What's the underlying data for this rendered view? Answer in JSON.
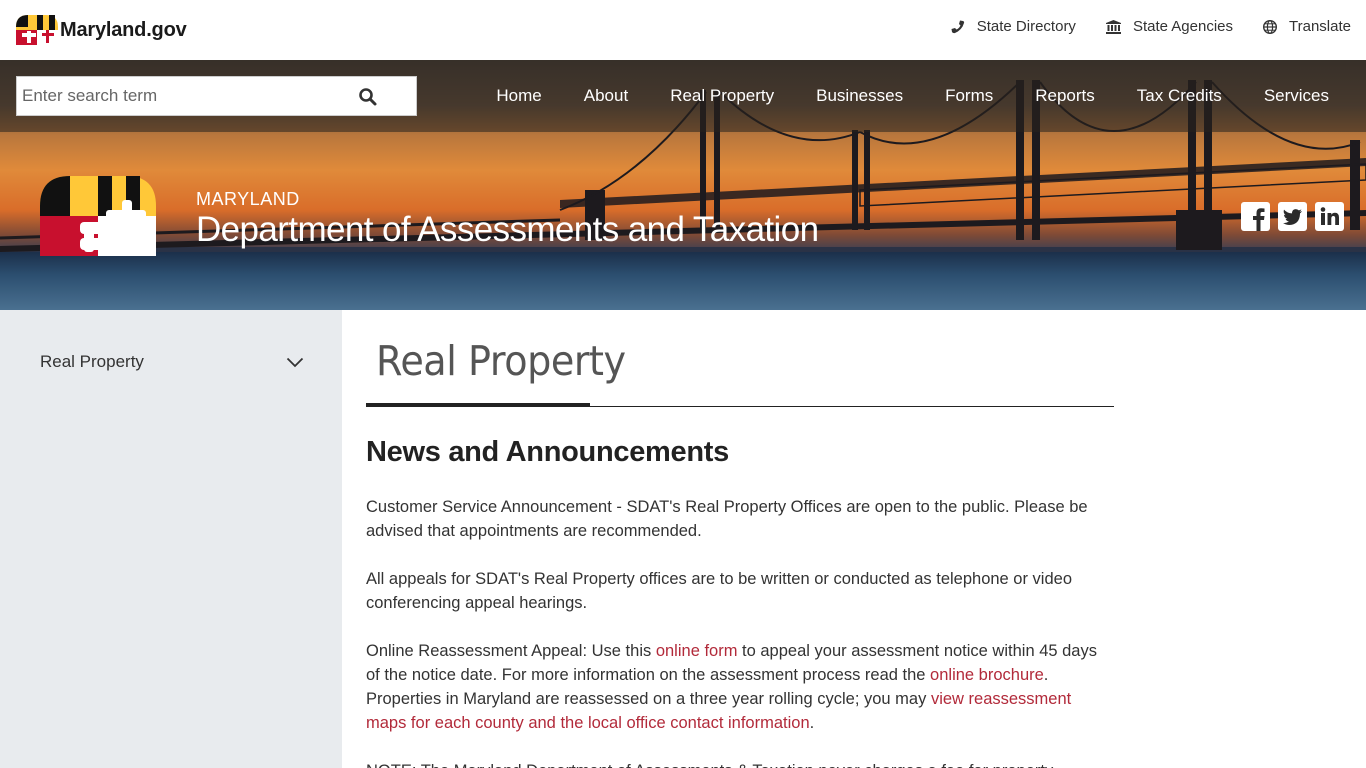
{
  "topbar": {
    "logo_text": "Maryland.gov",
    "links": [
      {
        "label": "State Directory",
        "icon": "phone-icon"
      },
      {
        "label": "State Agencies",
        "icon": "building-icon"
      },
      {
        "label": "Translate",
        "icon": "globe-icon"
      }
    ]
  },
  "search": {
    "placeholder": "Enter search term"
  },
  "nav": [
    "Home",
    "About",
    "Real Property",
    "Businesses",
    "Forms",
    "Reports",
    "Tax Credits",
    "Services"
  ],
  "header": {
    "state": "MARYLAND",
    "department": "Department of Assessments and Taxation",
    "social": [
      "facebook-icon",
      "twitter-icon",
      "linkedin-icon"
    ]
  },
  "sidebar": {
    "item": "Real Property"
  },
  "main": {
    "title": "Real Property",
    "section_heading": "News and Announcements",
    "p1": "Customer Service Announcement - SDAT's Real Property Offices are open to the public. Please be advised that appointments are recommended.",
    "p2": "All appeals for SDAT's Real Property offices are to be written or conducted as telephone or video conferencing appeal hearings.",
    "p3": {
      "t1": "Online Reassessment Appeal:  Use this ",
      "link1": "online form",
      "t2": " to appeal your assessment notice within 45 days of the notice date. For more information on the assessment process read the ",
      "link2": "online brochure",
      "t3": ". Properties in Maryland are reassessed on a three year rolling cycle; you may ",
      "link3": "view reassessment maps for each county and the local office contact information",
      "t4": "."
    },
    "p4": "NOTE: The Maryland Department of Assessments & Taxation never charges a fee for property"
  },
  "colors": {
    "link": "#b22a3a",
    "sidebar_bg": "#e8ebee",
    "flag_red": "#c8102e",
    "flag_gold": "#ffc838"
  }
}
